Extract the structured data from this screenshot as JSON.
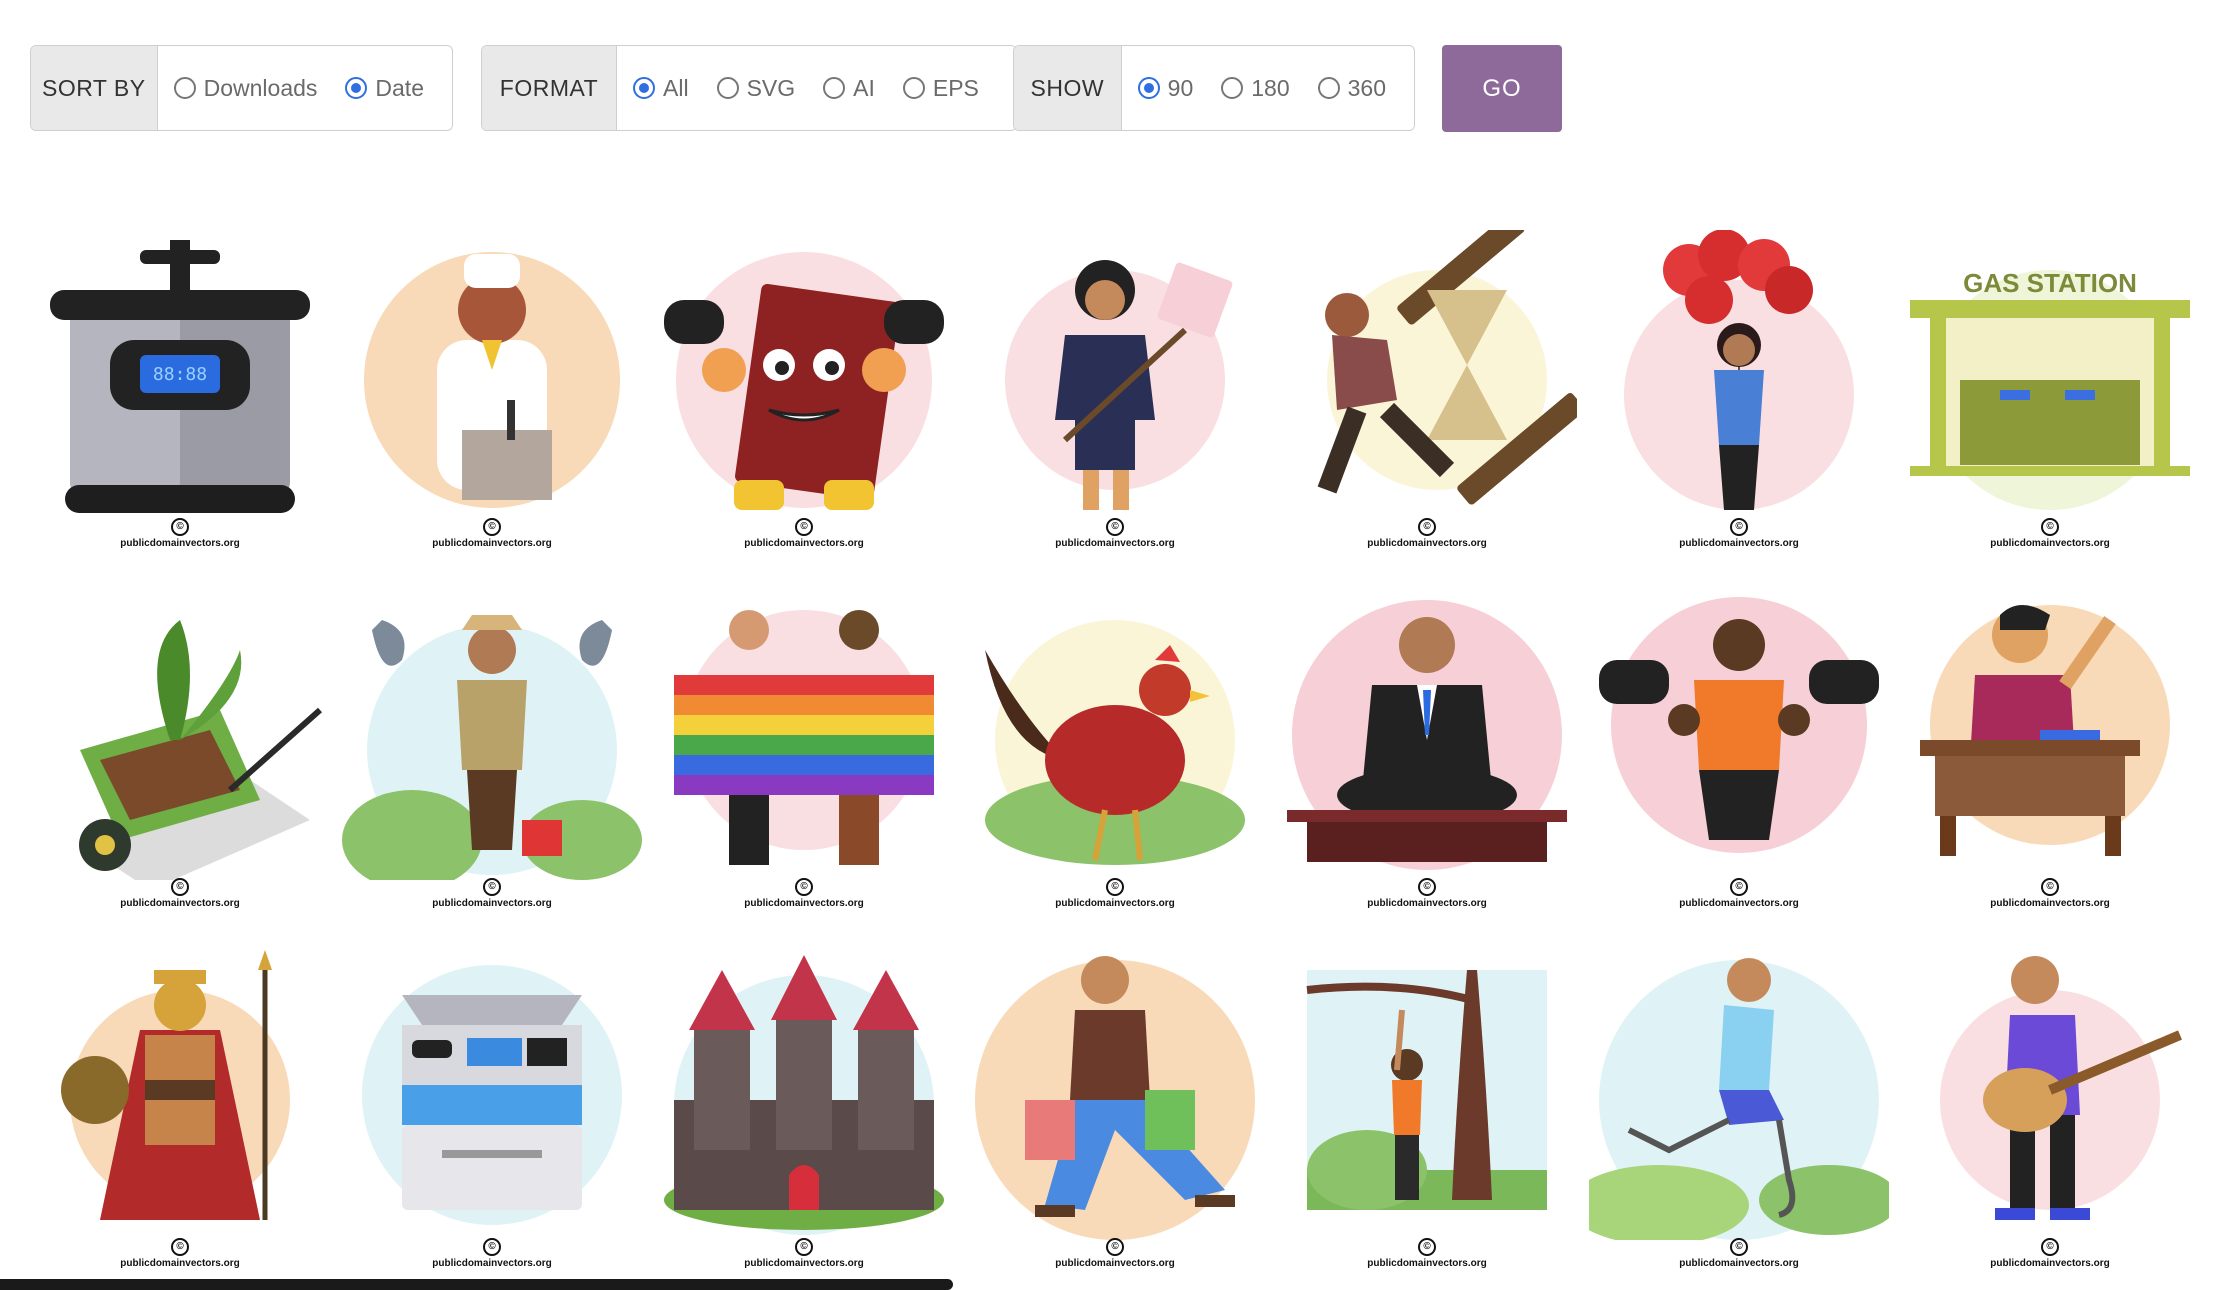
{
  "filters": {
    "sort": {
      "label": "SORT BY",
      "options": [
        {
          "label": "Downloads",
          "checked": false
        },
        {
          "label": "Date",
          "checked": true
        }
      ]
    },
    "format": {
      "label": "FORMAT",
      "options": [
        {
          "label": "All",
          "checked": true
        },
        {
          "label": "SVG",
          "checked": false
        },
        {
          "label": "AI",
          "checked": false
        },
        {
          "label": "EPS",
          "checked": false
        }
      ]
    },
    "show": {
      "label": "SHOW",
      "options": [
        {
          "label": "90",
          "checked": true
        },
        {
          "label": "180",
          "checked": false
        },
        {
          "label": "360",
          "checked": false
        }
      ]
    },
    "go_label": "GO"
  },
  "credit": {
    "symbol": "©",
    "site": "publicdomainvectors.org"
  },
  "colors": {
    "go_button": "#8e6a9a",
    "radio_checked": "#2f6fe0"
  },
  "gallery": [
    {
      "name": "pressure-cooker-icon",
      "bg": "none"
    },
    {
      "name": "chef-cooking-icon",
      "bg": "#f8d9b8"
    },
    {
      "name": "book-lifting-dumbbells-icon",
      "bg": "#f9dfe2"
    },
    {
      "name": "woman-with-sign-icon",
      "bg": "#f9dfe2"
    },
    {
      "name": "man-carrying-hourglass-icon",
      "bg": "#fbf5d8"
    },
    {
      "name": "woman-with-heart-balloons-icon",
      "bg": "#f9dfe2"
    },
    {
      "name": "gas-station-icon",
      "bg": "#eef5d8"
    },
    {
      "name": "wheelbarrow-plant-icon",
      "bg": "none"
    },
    {
      "name": "fisherman-icon",
      "bg": "#dff3f6"
    },
    {
      "name": "rainbow-flag-people-icon",
      "bg": "#f9dfe2"
    },
    {
      "name": "rooster-icon",
      "bg": "#fbf5d8"
    },
    {
      "name": "businessman-meditating-icon",
      "bg": "#f7cfd6"
    },
    {
      "name": "woman-lifting-dumbbells-icon",
      "bg": "#f7cfd6"
    },
    {
      "name": "student-at-desk-icon",
      "bg": "#f8d9b8"
    },
    {
      "name": "spartan-warrior-icon",
      "bg": "#f8d9b8"
    },
    {
      "name": "printer-copier-icon",
      "bg": "#dff3f6"
    },
    {
      "name": "castle-icon",
      "bg": "#dff3f6"
    },
    {
      "name": "man-shopping-bags-icon",
      "bg": "#f8d9b8"
    },
    {
      "name": "man-pruning-tree-icon",
      "bg": "#dff3f6"
    },
    {
      "name": "runner-prosthetic-legs-icon",
      "bg": "#dff3f6"
    },
    {
      "name": "guitar-player-icon",
      "bg": "#f9dfe2"
    }
  ]
}
